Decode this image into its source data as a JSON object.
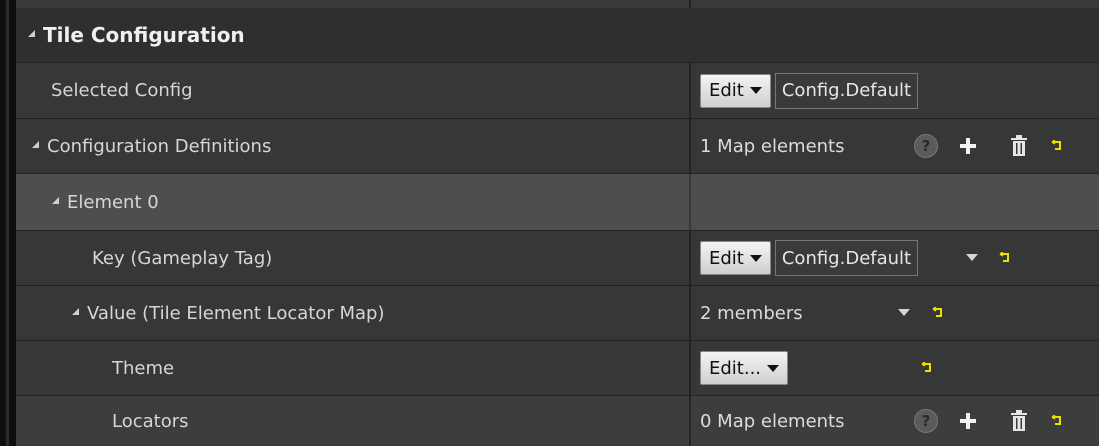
{
  "section": {
    "title": "Tile Configuration"
  },
  "rows": {
    "selected_config": {
      "label": "Selected Config",
      "edit_label": "Edit",
      "value": "Config.Default"
    },
    "config_definitions": {
      "label": "Configuration Definitions",
      "count_text": "1 Map elements",
      "help_icon": "?"
    },
    "element0": {
      "label": "Element 0"
    },
    "key": {
      "label": "Key (Gameplay Tag)",
      "edit_label": "Edit",
      "value": "Config.Default"
    },
    "value_map": {
      "label": "Value (Tile Element Locator Map)",
      "count_text": "2 members"
    },
    "theme": {
      "label": "Theme",
      "edit_label": "Edit..."
    },
    "locators": {
      "label": "Locators",
      "count_text": "0 Map elements",
      "help_icon": "?"
    }
  },
  "colors": {
    "background": "#373737",
    "header": "#2f2f2f",
    "selected_row": "#4e4e4e",
    "reset_arrow": "#e8e000"
  },
  "icons": [
    "expand-triangle-icon",
    "help-icon",
    "plus-icon",
    "trash-icon",
    "reset-to-default-icon",
    "dropdown-arrow-icon"
  ]
}
